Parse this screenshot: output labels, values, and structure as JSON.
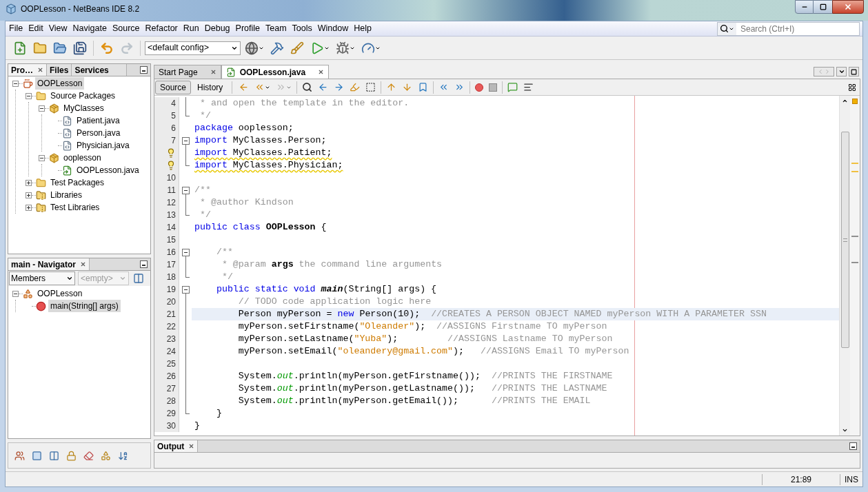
{
  "window": {
    "title": "OOPLesson - NetBeans IDE 8.2"
  },
  "menu": [
    "File",
    "Edit",
    "View",
    "Navigate",
    "Source",
    "Refactor",
    "Run",
    "Debug",
    "Profile",
    "Team",
    "Tools",
    "Window",
    "Help"
  ],
  "search": {
    "placeholder": "Search (Ctrl+I)"
  },
  "toolbar": {
    "config": "<default config>"
  },
  "projects_panel": {
    "tabs": [
      {
        "label": "Pro…",
        "selected": true
      },
      {
        "label": "Files",
        "selected": false
      },
      {
        "label": "Services",
        "selected": false
      }
    ],
    "tree": [
      {
        "label": "OOPLesson",
        "kind": "project",
        "expanded": true,
        "selected": true,
        "children": [
          {
            "label": "Source Packages",
            "kind": "source-folder",
            "expanded": true,
            "selected": false,
            "children": [
              {
                "label": "MyClasses",
                "kind": "package",
                "expanded": true,
                "selected": false,
                "children": [
                  {
                    "label": "Patient.java",
                    "kind": "java-file",
                    "selected": false
                  },
                  {
                    "label": "Person.java",
                    "kind": "java-file",
                    "selected": false
                  },
                  {
                    "label": "Physician.java",
                    "kind": "java-file",
                    "selected": false
                  }
                ]
              },
              {
                "label": "ooplesson",
                "kind": "package",
                "expanded": true,
                "selected": false,
                "children": [
                  {
                    "label": "OOPLesson.java",
                    "kind": "main-file",
                    "selected": false
                  }
                ]
              }
            ]
          },
          {
            "label": "Test Packages",
            "kind": "source-folder",
            "expanded": false,
            "selected": false
          },
          {
            "label": "Libraries",
            "kind": "library",
            "expanded": false,
            "selected": false
          },
          {
            "label": "Test Libraries",
            "kind": "library",
            "expanded": false,
            "selected": false
          }
        ]
      }
    ]
  },
  "navigator": {
    "title": "main - Navigator",
    "members": "Members",
    "filter": "<empty>",
    "tree": [
      {
        "label": "OOPLesson",
        "kind": "class",
        "expanded": true,
        "selected": false,
        "children": [
          {
            "label": "main(String[] args)",
            "kind": "method",
            "selected": true
          }
        ]
      }
    ]
  },
  "editor": {
    "tabs": [
      {
        "label": "Start Page",
        "selected": false
      },
      {
        "label": "OOPLesson.java",
        "selected": true
      }
    ],
    "views": [
      {
        "label": "Source",
        "selected": true
      },
      {
        "label": "History",
        "selected": false
      }
    ],
    "lines": [
      {
        "number": "4",
        "fold": {
          "kind": "line"
        },
        "tokens": [
          {
            "kind": "comment",
            "text": " * and open the template in the editor."
          }
        ]
      },
      {
        "number": "5",
        "fold": {
          "kind": "end"
        },
        "tokens": [
          {
            "kind": "comment",
            "text": " */"
          }
        ]
      },
      {
        "number": "6",
        "tokens": [
          {
            "kind": "keyword",
            "text": "package"
          },
          {
            "kind": "text",
            "text": " ooplesson;"
          }
        ]
      },
      {
        "number": "7",
        "fold": {
          "kind": "open"
        },
        "tokens": [
          {
            "kind": "keyword",
            "text": "import"
          },
          {
            "kind": "text",
            "text": " MyClasses.Person;"
          }
        ]
      },
      {
        "warning": true,
        "fold": {
          "kind": "line"
        },
        "tokens": [
          {
            "kind": "keyword",
            "text": "import"
          },
          {
            "kind": "text",
            "text": " MyClasses.Patient;"
          }
        ]
      },
      {
        "warning": true,
        "fold": {
          "kind": "end"
        },
        "tokens": [
          {
            "kind": "keyword",
            "text": "import"
          },
          {
            "kind": "text",
            "text": " MyClasses.Physician;"
          }
        ]
      },
      {
        "number": "10"
      },
      {
        "number": "11",
        "fold": {
          "kind": "open"
        },
        "tokens": [
          {
            "kind": "comment",
            "text": "/**"
          }
        ]
      },
      {
        "number": "12",
        "fold": {
          "kind": "line"
        },
        "tokens": [
          {
            "kind": "comment",
            "text": " * @author Kindson"
          }
        ]
      },
      {
        "number": "13",
        "fold": {
          "kind": "end"
        },
        "tokens": [
          {
            "kind": "comment",
            "text": " */"
          }
        ]
      },
      {
        "number": "14",
        "tokens": [
          {
            "kind": "keyword",
            "text": "public class "
          },
          {
            "kind": "class-name",
            "text": "OOPLesson"
          },
          {
            "kind": "text",
            "text": " {"
          }
        ]
      },
      {
        "number": "15"
      },
      {
        "number": "16",
        "fold": {
          "kind": "open"
        },
        "tokens": [
          {
            "kind": "comment",
            "text": "    /**"
          }
        ]
      },
      {
        "number": "17",
        "fold": {
          "kind": "line"
        },
        "tokens": [
          {
            "kind": "comment",
            "text": "     * @param "
          },
          {
            "kind": "param",
            "text": "args"
          },
          {
            "kind": "comment",
            "text": " the command line arguments"
          }
        ]
      },
      {
        "number": "18",
        "fold": {
          "kind": "end"
        },
        "tokens": [
          {
            "kind": "comment",
            "text": "     */"
          }
        ]
      },
      {
        "number": "19",
        "fold": {
          "kind": "open"
        },
        "tokens": [
          {
            "kind": "keyword",
            "text": "    public static void "
          },
          {
            "kind": "method-name",
            "text": "main"
          },
          {
            "kind": "text",
            "text": "(String[] args) {"
          }
        ]
      },
      {
        "number": "20",
        "fold": {
          "kind": "line"
        },
        "tokens": [
          {
            "kind": "comment",
            "text": "        // TODO code application logic here"
          }
        ]
      },
      {
        "number": "21",
        "fold": {
          "kind": "line"
        },
        "current": true,
        "tokens": [
          {
            "kind": "text",
            "text": "        Person myPerson = "
          },
          {
            "kind": "keyword",
            "text": "new"
          },
          {
            "kind": "text",
            "text": " Person(10);  "
          },
          {
            "kind": "comment",
            "text": "//CREATES A PERSON OBJECT NAMED myPerson WITH A PARAMETER SSN"
          }
        ]
      },
      {
        "number": "22",
        "fold": {
          "kind": "line"
        },
        "tokens": [
          {
            "kind": "text",
            "text": "        myPerson.setFirstname("
          },
          {
            "kind": "string",
            "text": "\"Oleander\""
          },
          {
            "kind": "text",
            "text": ");  "
          },
          {
            "kind": "comment",
            "text": "//ASSIGNS Firstname TO myPerson"
          }
        ]
      },
      {
        "number": "23",
        "fold": {
          "kind": "line"
        },
        "tokens": [
          {
            "kind": "text",
            "text": "        myPerson.setLastname("
          },
          {
            "kind": "string",
            "text": "\"Yuba\""
          },
          {
            "kind": "text",
            "text": ");         "
          },
          {
            "kind": "comment",
            "text": "//ASSIGNS Lastname TO myPerson"
          }
        ]
      },
      {
        "number": "24",
        "fold": {
          "kind": "line"
        },
        "tokens": [
          {
            "kind": "text",
            "text": "        myPerson.setEmail("
          },
          {
            "kind": "string",
            "text": "\"oleandery@gmail.com\""
          },
          {
            "kind": "text",
            "text": ");   "
          },
          {
            "kind": "comment",
            "text": "//ASSIGNS Email TO myPerson"
          }
        ]
      },
      {
        "number": "25",
        "fold": {
          "kind": "line"
        }
      },
      {
        "number": "26",
        "fold": {
          "kind": "line"
        },
        "tokens": [
          {
            "kind": "text",
            "text": "        System."
          },
          {
            "kind": "field",
            "text": "out"
          },
          {
            "kind": "text",
            "text": ".println(myPerson.getFirstname());  "
          },
          {
            "kind": "comment",
            "text": "//PRINTS THE FIRSTNAME"
          }
        ]
      },
      {
        "number": "27",
        "fold": {
          "kind": "line"
        },
        "tokens": [
          {
            "kind": "text",
            "text": "        System."
          },
          {
            "kind": "field",
            "text": "out"
          },
          {
            "kind": "text",
            "text": ".println(myPerson.getLastname());   "
          },
          {
            "kind": "comment",
            "text": "//PRINTS THE LASTNAME"
          }
        ]
      },
      {
        "number": "28",
        "fold": {
          "kind": "line"
        },
        "tokens": [
          {
            "kind": "text",
            "text": "        System."
          },
          {
            "kind": "field",
            "text": "out"
          },
          {
            "kind": "text",
            "text": ".println(myPerson.getEmail());      "
          },
          {
            "kind": "comment",
            "text": "//PRINTS THE EMAIL"
          }
        ]
      },
      {
        "number": "29",
        "fold": {
          "kind": "end"
        },
        "tokens": [
          {
            "kind": "text",
            "text": "    }"
          }
        ]
      },
      {
        "number": "30",
        "tokens": [
          {
            "kind": "text",
            "text": "}"
          }
        ]
      }
    ]
  },
  "output": {
    "title": "Output"
  },
  "status_bar": {
    "position": "21:89",
    "mode": "INS"
  }
}
